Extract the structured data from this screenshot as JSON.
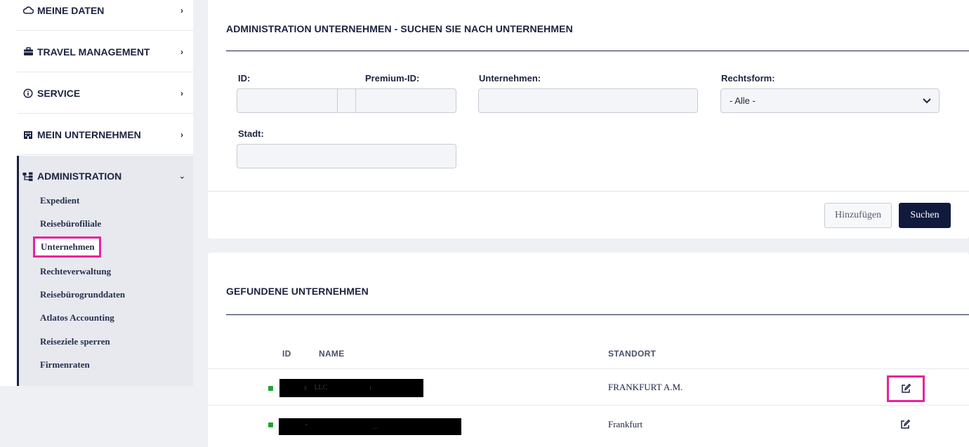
{
  "sidebar": {
    "items": [
      {
        "label": "MEINE DATEN",
        "icon": "cloud-icon"
      },
      {
        "label": "TRAVEL MANAGEMENT",
        "icon": "briefcase-icon"
      },
      {
        "label": "SERVICE",
        "icon": "info-icon"
      },
      {
        "label": "MEIN UNTERNEHMEN",
        "icon": "building-icon"
      }
    ],
    "admin": {
      "label": "ADMINISTRATION",
      "icon": "sitemap-icon",
      "subitems": [
        {
          "label": "Expedient"
        },
        {
          "label": "Reisebürofiliale"
        },
        {
          "label": "Unternehmen",
          "active": true
        },
        {
          "label": "Rechteverwaltung"
        },
        {
          "label": "Reisebürogrunddaten"
        },
        {
          "label": "Atlatos Accounting"
        },
        {
          "label": "Reiseziele sperren"
        },
        {
          "label": "Firmenraten"
        }
      ]
    }
  },
  "search": {
    "title": "ADMINISTRATION UNTERNEHMEN - SUCHEN SIE NACH UNTERNEHMEN",
    "fields": {
      "id_label": "ID:",
      "id_value": "",
      "premium_label": "Premium-ID:",
      "premium_value": "",
      "company_label": "Unternehmen:",
      "company_value": "",
      "legal_label": "Rechtsform:",
      "legal_selected": "- Alle -",
      "city_label": "Stadt:",
      "city_value": ""
    },
    "add_label": "Hinzufügen",
    "search_label": "Suchen"
  },
  "results": {
    "title": "GEFUNDENE UNTERNEHMEN",
    "headers": {
      "id": "ID",
      "name": "NAME",
      "location": "STANDORT"
    },
    "rows": [
      {
        "status": "active",
        "name_redacted": "  z    LLC                        ι",
        "location": "FRANKFURT A.M."
      },
      {
        "status": "active",
        "name_redacted": "   ''                                     ...",
        "location": "Frankfurt"
      }
    ]
  },
  "colors": {
    "navy": "#1c2340",
    "highlight": "#e8239c",
    "status_green": "#1ea534"
  }
}
